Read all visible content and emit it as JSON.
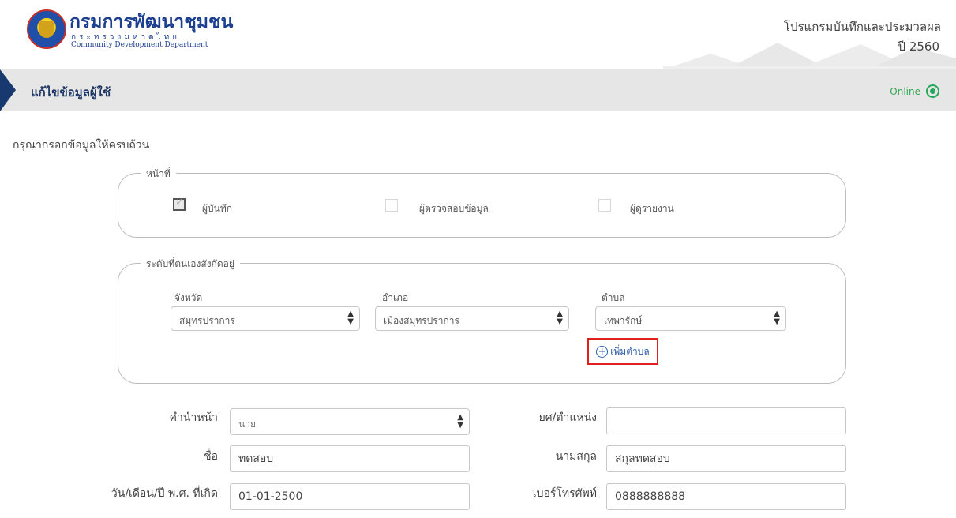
{
  "header": {
    "logo_title": "กรมการพัฒนาชุมชน",
    "logo_sub_thai": "กระทรวงมหาดไทย",
    "logo_sub_en": "Community Development Department",
    "program_name": "โปรแกรมบันทึกและประมวลผล",
    "program_year": "ปี 2560"
  },
  "titlebar": {
    "title": "แก้ไขข้อมูลผู้ใช้",
    "status": "Online"
  },
  "form": {
    "instruction": "กรุณากรอกข้อมูลให้ครบถ้วน",
    "duty": {
      "legend": "หน้าที่",
      "options": [
        {
          "label": "ผู้บันทึก",
          "checked": true
        },
        {
          "label": "ผู้ตรวจสอบข้อมูล",
          "checked": false
        },
        {
          "label": "ผู้ดูรายงาน",
          "checked": false
        }
      ]
    },
    "level": {
      "legend": "ระดับที่ตนเองสังกัดอยู่",
      "province_label": "จังหวัด",
      "province_value": "สมุทรปราการ",
      "district_label": "อำเภอ",
      "district_value": "เมืองสมุทรปราการ",
      "subdistrict_label": "ตำบล",
      "subdistrict_value": "เทพารักษ์",
      "add_subdistrict": "เพิ่มตำบล"
    },
    "fields": {
      "prefix_label": "คำนำหน้า",
      "prefix_value": "นาย",
      "rank_label": "ยศ/ตำแหน่ง",
      "rank_value": "",
      "firstname_label": "ชื่อ",
      "firstname_value": "ทดสอบ",
      "lastname_label": "นามสกุล",
      "lastname_value": "สกุลทดสอบ",
      "birthdate_label": "วัน/เดือน/ปี พ.ศ. ที่เกิด",
      "birthdate_value": "01-01-2500",
      "phone_label": "เบอร์โทรศัพท์",
      "phone_value": "0888888888"
    }
  },
  "colors": {
    "navy": "#18396f",
    "online_green": "#27a85a",
    "highlight_red": "#e0201e",
    "link_blue": "#2b5da8"
  }
}
